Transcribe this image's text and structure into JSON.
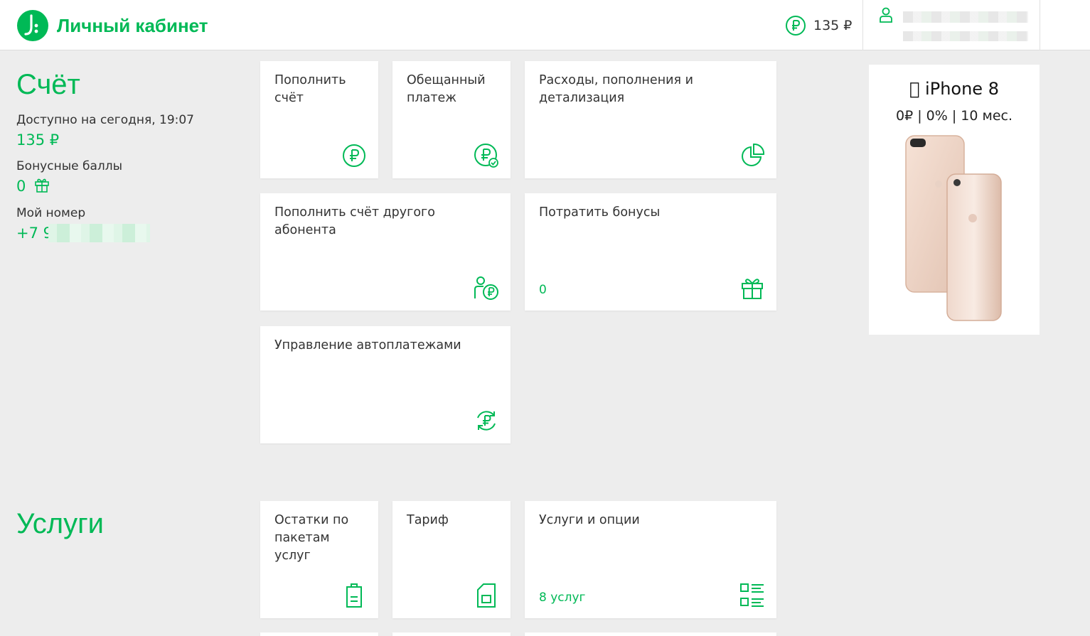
{
  "header": {
    "logo_text": "Личный кабинет",
    "balance": "135 ₽"
  },
  "account": {
    "title": "Счёт",
    "available_label": "Доступно на сегодня, 19:07",
    "available_value": "135 ₽",
    "bonus_label": "Бонусные баллы",
    "bonus_value": "0",
    "number_label": "Мой номер",
    "number_value": "+7 9"
  },
  "account_tiles": [
    {
      "label": "Пополнить счёт",
      "icon": "ruble-circle-icon"
    },
    {
      "label": "Обещанный платеж",
      "icon": "ruble-check-icon"
    },
    {
      "label": "Расходы, пополнения и детализация",
      "icon": "pie-chart-icon"
    },
    {
      "label": "Пополнить счёт другого абонента",
      "icon": "person-ruble-icon"
    },
    {
      "label": "Потратить бонусы",
      "sub": "0",
      "icon": "gift-icon"
    },
    {
      "label": "Управление автоплатежами",
      "icon": "autopay-icon"
    }
  ],
  "services": {
    "title": "Услуги",
    "tiles": [
      {
        "label": "Остатки по пакетам услуг",
        "icon": "battery-icon"
      },
      {
        "label": "Тариф",
        "icon": "sim-card-icon"
      },
      {
        "label": "Услуги и опции",
        "sub": "8 услуг",
        "icon": "options-list-icon"
      }
    ]
  },
  "promo": {
    "title": "iPhone 8",
    "terms": "0₽ | 0% | 10 мес."
  },
  "colors": {
    "accent": "#00b956",
    "background": "#ededed",
    "card": "#ffffff"
  }
}
